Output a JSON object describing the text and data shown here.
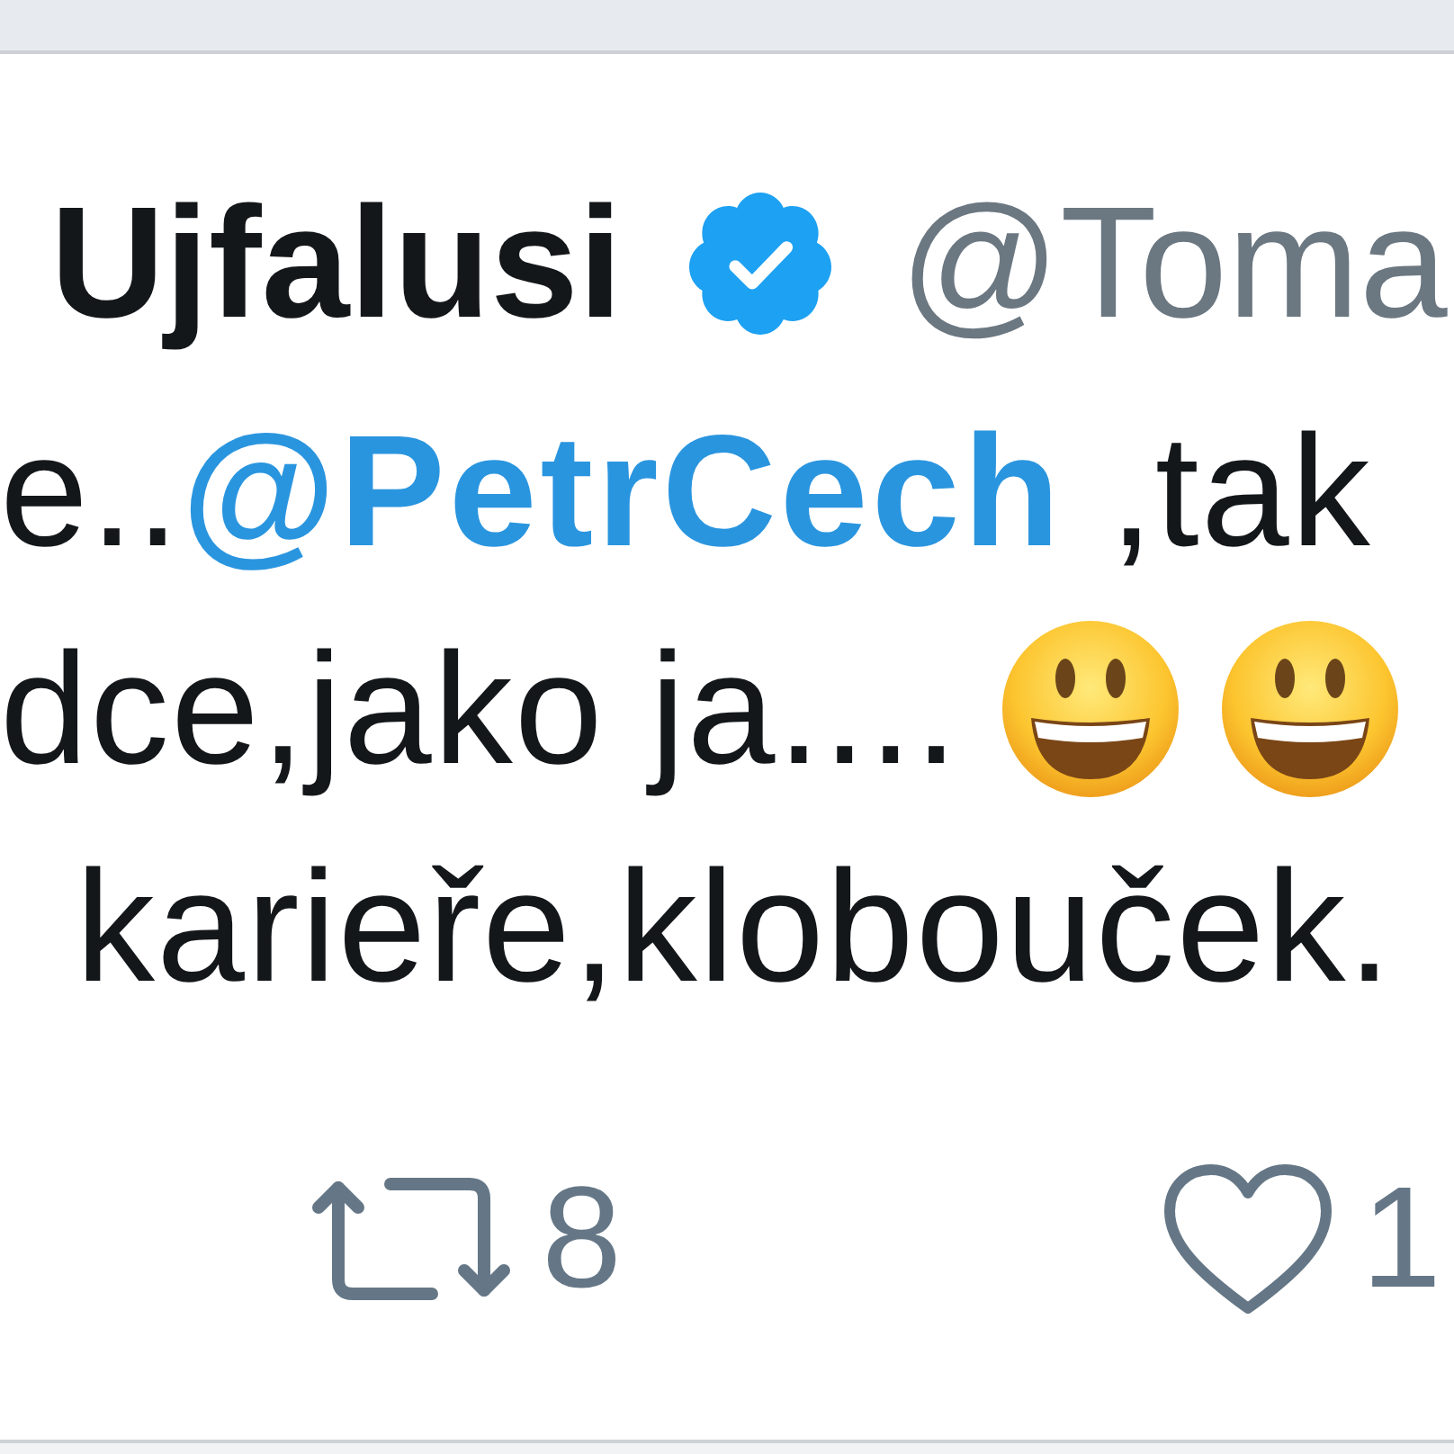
{
  "tweet": {
    "author": {
      "name": "Ujfalusi",
      "verified": true,
      "handle": "@Toma"
    },
    "text_lines": [
      {
        "segments": [
          {
            "kind": "text",
            "text": "e.."
          },
          {
            "kind": "mention",
            "text": "@PetrCech"
          },
          {
            "kind": "text",
            "text": " ,tak"
          }
        ]
      },
      {
        "segments": [
          {
            "kind": "text",
            "text": "dce,jako ja...."
          },
          {
            "kind": "emoji"
          },
          {
            "kind": "emoji"
          }
        ]
      },
      {
        "segments": [
          {
            "kind": "text",
            "text": "karieře,klobouček."
          }
        ]
      }
    ],
    "actions": [
      {
        "kind": "retweet",
        "count": "8"
      },
      {
        "kind": "like",
        "count": "1"
      }
    ]
  }
}
